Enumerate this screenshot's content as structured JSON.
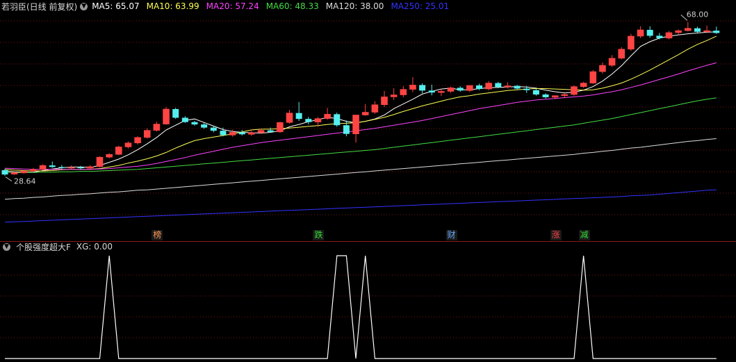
{
  "main_panel": {
    "title": "若羽臣(日线 前复权)",
    "expand_icon": "chevron-down-icon",
    "ma_legend": [
      {
        "label": "MA5: 65.07",
        "color": "#ffffff"
      },
      {
        "label": "MA10: 63.99",
        "color": "#ffff55"
      },
      {
        "label": "MA20: 57.24",
        "color": "#ff44ff"
      },
      {
        "label": "MA60: 48.33",
        "color": "#44dd44"
      },
      {
        "label": "MA120: 38.00",
        "color": "#dddddd"
      },
      {
        "label": "MA250: 25.01",
        "color": "#3333ff"
      }
    ],
    "high_label": "68.00",
    "low_label": "28.64",
    "event_tags": [
      {
        "text": "榜",
        "color": "#ff9955"
      },
      {
        "text": "跌",
        "color": "#33dd33"
      },
      {
        "text": "财",
        "color": "#66aaff"
      },
      {
        "text": "涨",
        "color": "#ff4444"
      },
      {
        "text": "减",
        "color": "#33dd33"
      }
    ]
  },
  "indicator_panel": {
    "title": "个股强度超大F",
    "expand_icon": "chevron-down-icon",
    "value_label": "XG: 0.00",
    "line_color": "#ffffff"
  },
  "colors": {
    "background": "#000000",
    "up_candle": "#ff4444",
    "down_candle": "#55eeee",
    "grid": "#7a1414",
    "separator": "#8b1a1a"
  },
  "chart_data": [
    {
      "type": "candlestick",
      "series_name": "若羽臣(日线 前复权)",
      "ohlc": [
        [
          30.0,
          30.3,
          28.6,
          28.9
        ],
        [
          29.0,
          29.6,
          28.8,
          29.4
        ],
        [
          29.3,
          29.9,
          29.1,
          29.8
        ],
        [
          29.8,
          30.6,
          29.5,
          30.2
        ],
        [
          30.2,
          31.5,
          30.0,
          31.2
        ],
        [
          31.2,
          32.2,
          30.6,
          30.8
        ],
        [
          30.8,
          31.3,
          30.2,
          30.6
        ],
        [
          30.6,
          31.2,
          30.3,
          30.7
        ],
        [
          30.7,
          31.1,
          30.1,
          30.5
        ],
        [
          30.5,
          31.3,
          30.2,
          30.9
        ],
        [
          30.9,
          33.5,
          30.7,
          33.3
        ],
        [
          33.3,
          34.3,
          33.0,
          34.0
        ],
        [
          34.0,
          36.2,
          33.8,
          35.9
        ],
        [
          35.9,
          37.3,
          35.5,
          36.9
        ],
        [
          36.9,
          38.6,
          36.5,
          38.3
        ],
        [
          38.3,
          40.6,
          38.0,
          40.1
        ],
        [
          40.1,
          42.3,
          39.8,
          41.7
        ],
        [
          41.7,
          46.0,
          41.5,
          45.5
        ],
        [
          45.5,
          45.8,
          43.0,
          43.3
        ],
        [
          43.3,
          43.7,
          42.0,
          42.2
        ],
        [
          42.2,
          42.5,
          41.3,
          41.6
        ],
        [
          41.6,
          42.0,
          40.5,
          40.8
        ],
        [
          40.8,
          41.2,
          39.6,
          40.0
        ],
        [
          40.0,
          40.8,
          38.6,
          38.9
        ],
        [
          38.9,
          40.3,
          38.5,
          39.6
        ],
        [
          39.6,
          40.2,
          38.8,
          39.1
        ],
        [
          39.1,
          40.0,
          38.7,
          39.5
        ],
        [
          39.5,
          40.5,
          39.2,
          40.1
        ],
        [
          40.1,
          40.8,
          39.5,
          39.7
        ],
        [
          39.7,
          42.3,
          39.5,
          42.1
        ],
        [
          42.1,
          45.3,
          41.8,
          44.5
        ],
        [
          44.5,
          47.3,
          42.5,
          43.0
        ],
        [
          43.0,
          43.5,
          41.6,
          42.2
        ],
        [
          42.2,
          43.5,
          41.0,
          43.1
        ],
        [
          43.1,
          45.8,
          42.8,
          44.2
        ],
        [
          44.2,
          44.6,
          41.0,
          41.4
        ],
        [
          41.4,
          42.6,
          38.6,
          39.2
        ],
        [
          39.2,
          41.7,
          37.0,
          44.0
        ],
        [
          44.0,
          46.8,
          43.8,
          44.7
        ],
        [
          44.7,
          47.5,
          44.3,
          46.6
        ],
        [
          46.6,
          50.1,
          46.1,
          48.6
        ],
        [
          48.6,
          50.8,
          47.8,
          49.1
        ],
        [
          49.1,
          51.3,
          48.5,
          50.5
        ],
        [
          50.5,
          53.6,
          49.8,
          51.6
        ],
        [
          51.6,
          52.0,
          49.5,
          50.2
        ],
        [
          50.2,
          51.7,
          49.0,
          49.7
        ],
        [
          49.7,
          50.6,
          48.8,
          50.0
        ],
        [
          50.0,
          51.2,
          49.6,
          50.9
        ],
        [
          50.9,
          51.3,
          49.9,
          50.2
        ],
        [
          50.2,
          51.5,
          49.8,
          51.5
        ],
        [
          51.5,
          51.9,
          50.3,
          50.6
        ],
        [
          50.6,
          52.6,
          50.3,
          52.1
        ],
        [
          52.1,
          52.4,
          50.8,
          51.1
        ],
        [
          51.1,
          52.3,
          50.7,
          51.4
        ],
        [
          51.4,
          51.6,
          50.4,
          50.7
        ],
        [
          50.7,
          51.4,
          49.6,
          50.3
        ],
        [
          50.3,
          50.7,
          48.9,
          49.2
        ],
        [
          49.2,
          49.5,
          48.2,
          48.5
        ],
        [
          48.5,
          49.0,
          48.0,
          48.9
        ],
        [
          48.9,
          49.5,
          48.3,
          49.2
        ],
        [
          49.2,
          51.5,
          48.9,
          51.2
        ],
        [
          51.2,
          52.4,
          50.9,
          52.1
        ],
        [
          52.1,
          55.4,
          51.9,
          55.0
        ],
        [
          55.0,
          57.3,
          54.5,
          56.6
        ],
        [
          56.6,
          59.2,
          56.2,
          58.4
        ],
        [
          58.4,
          61.2,
          58.1,
          60.7
        ],
        [
          60.7,
          64.6,
          60.3,
          64.0
        ],
        [
          64.0,
          66.5,
          63.5,
          65.6
        ],
        [
          65.6,
          66.5,
          63.6,
          64.1
        ],
        [
          64.1,
          64.8,
          63.2,
          63.5
        ],
        [
          63.5,
          65.3,
          63.2,
          64.9
        ],
        [
          64.9,
          65.7,
          64.3,
          65.4
        ],
        [
          65.4,
          67.6,
          65.2,
          66.0
        ],
        [
          66.0,
          66.4,
          64.7,
          65.1
        ],
        [
          65.1,
          66.7,
          64.8,
          65.4
        ],
        [
          65.4,
          66.4,
          64.6,
          64.8
        ]
      ],
      "ma": {
        "MA5": [
          29.8,
          29.6,
          29.5,
          29.5,
          29.9,
          30.3,
          30.6,
          30.8,
          30.8,
          30.7,
          31.2,
          32.0,
          32.8,
          33.9,
          35.2,
          36.7,
          38.3,
          40.2,
          41.4,
          42.6,
          43.0,
          42.1,
          41.2,
          40.3,
          39.8,
          39.6,
          39.5,
          39.4,
          39.6,
          40.0,
          41.0,
          41.6,
          42.3,
          42.8,
          43.4,
          43.1,
          42.4,
          42.0,
          42.4,
          43.0,
          44.0,
          45.6,
          46.8,
          48.0,
          49.3,
          50.0,
          50.6,
          50.8,
          50.4,
          50.4,
          50.7,
          50.9,
          51.0,
          51.1,
          51.2,
          51.1,
          50.8,
          50.3,
          49.9,
          49.6,
          49.8,
          50.3,
          51.2,
          52.6,
          54.4,
          56.5,
          59.0,
          61.4,
          62.6,
          63.5,
          64.0,
          64.3,
          64.6,
          64.8,
          65.0,
          65.1
        ],
        "MA10": [
          30.2,
          30.0,
          29.9,
          29.8,
          29.8,
          29.9,
          30.1,
          30.2,
          30.2,
          30.2,
          30.4,
          30.8,
          31.2,
          31.8,
          32.3,
          32.9,
          33.6,
          34.5,
          35.6,
          36.6,
          37.5,
          38.0,
          38.4,
          38.8,
          39.2,
          39.7,
          40.2,
          40.4,
          40.4,
          40.5,
          40.7,
          40.9,
          41.1,
          41.3,
          41.6,
          41.8,
          41.9,
          42.0,
          42.4,
          42.9,
          43.4,
          44.1,
          44.9,
          45.6,
          46.3,
          46.9,
          47.5,
          48.1,
          48.6,
          48.9,
          49.3,
          49.6,
          49.9,
          50.2,
          50.4,
          50.6,
          50.7,
          50.7,
          50.6,
          50.5,
          50.4,
          50.3,
          50.4,
          50.8,
          51.4,
          52.1,
          53.1,
          54.2,
          55.4,
          56.7,
          58.0,
          59.3,
          60.7,
          61.9,
          62.9,
          63.99
        ],
        "MA20": [
          30.5,
          30.4,
          30.3,
          30.2,
          30.2,
          30.2,
          30.2,
          30.2,
          30.2,
          30.2,
          30.3,
          30.4,
          30.6,
          30.8,
          31.0,
          31.3,
          31.7,
          32.2,
          32.7,
          33.2,
          33.8,
          34.3,
          34.8,
          35.3,
          35.8,
          36.2,
          36.6,
          37.0,
          37.3,
          37.6,
          37.9,
          38.2,
          38.5,
          38.8,
          39.1,
          39.4,
          39.7,
          40.0,
          40.3,
          40.6,
          41.0,
          41.4,
          41.8,
          42.2,
          42.6,
          43.1,
          43.6,
          44.1,
          44.6,
          45.1,
          45.6,
          46.0,
          46.4,
          46.8,
          47.2,
          47.5,
          47.8,
          48.0,
          48.2,
          48.4,
          48.6,
          48.8,
          49.1,
          49.5,
          49.9,
          50.4,
          51.0,
          51.6,
          52.3,
          53.0,
          53.7,
          54.4,
          55.2,
          55.9,
          56.6,
          57.24
        ],
        "MA60": [
          29.4,
          29.4,
          29.4,
          29.4,
          29.5,
          29.5,
          29.6,
          29.6,
          29.7,
          29.7,
          29.8,
          29.9,
          30.0,
          30.1,
          30.2,
          30.4,
          30.6,
          30.8,
          31.0,
          31.2,
          31.4,
          31.6,
          31.8,
          32.0,
          32.2,
          32.4,
          32.6,
          32.8,
          33.0,
          33.2,
          33.4,
          33.6,
          33.8,
          34.0,
          34.2,
          34.4,
          34.6,
          34.8,
          35.0,
          35.2,
          35.5,
          35.8,
          36.1,
          36.4,
          36.7,
          37.0,
          37.3,
          37.6,
          37.9,
          38.2,
          38.5,
          38.8,
          39.1,
          39.4,
          39.7,
          40.0,
          40.3,
          40.6,
          40.9,
          41.2,
          41.5,
          41.9,
          42.3,
          42.7,
          43.1,
          43.6,
          44.1,
          44.6,
          45.1,
          45.6,
          46.1,
          46.6,
          47.1,
          47.6,
          48.0,
          48.33
        ],
        "MA120": [
          22.6,
          22.8,
          22.9,
          23.1,
          23.2,
          23.4,
          23.6,
          23.7,
          23.9,
          24.0,
          24.2,
          24.4,
          24.5,
          24.7,
          24.9,
          25.0,
          25.2,
          25.4,
          25.6,
          25.8,
          26.0,
          26.2,
          26.4,
          26.6,
          26.8,
          27.0,
          27.2,
          27.4,
          27.6,
          27.8,
          28.0,
          28.2,
          28.4,
          28.6,
          28.8,
          29.0,
          29.2,
          29.4,
          29.6,
          29.8,
          30.0,
          30.2,
          30.4,
          30.6,
          30.8,
          31.0,
          31.2,
          31.4,
          31.6,
          31.8,
          32.0,
          32.2,
          32.4,
          32.6,
          32.8,
          33.0,
          33.2,
          33.4,
          33.6,
          33.8,
          34.0,
          34.3,
          34.5,
          34.8,
          35.0,
          35.3,
          35.6,
          35.8,
          36.1,
          36.4,
          36.7,
          37.0,
          37.3,
          37.5,
          37.8,
          38.0
        ],
        "MA250": [
          16.8,
          16.9,
          17.0,
          17.1,
          17.2,
          17.3,
          17.4,
          17.5,
          17.6,
          17.7,
          17.8,
          17.9,
          18.0,
          18.1,
          18.2,
          18.3,
          18.4,
          18.5,
          18.6,
          18.7,
          18.8,
          18.9,
          19.0,
          19.1,
          19.2,
          19.3,
          19.4,
          19.5,
          19.6,
          19.7,
          19.8,
          19.9,
          20.0,
          20.1,
          20.2,
          20.3,
          20.4,
          20.5,
          20.6,
          20.7,
          20.8,
          20.9,
          21.0,
          21.1,
          21.2,
          21.3,
          21.4,
          21.5,
          21.6,
          21.7,
          21.8,
          21.9,
          22.0,
          22.1,
          22.2,
          22.3,
          22.4,
          22.5,
          22.6,
          22.7,
          22.8,
          22.9,
          23.0,
          23.1,
          23.2,
          23.3,
          23.5,
          23.6,
          23.7,
          23.9,
          24.1,
          24.3,
          24.5,
          24.7,
          24.9,
          25.01
        ]
      },
      "high_marker": {
        "bar": 72,
        "value": 68.0
      },
      "low_marker": {
        "bar": 0,
        "value": 28.64
      },
      "event_tags": [
        {
          "bar": 16,
          "text": "榜"
        },
        {
          "bar": 33,
          "text": "跌"
        },
        {
          "bar": 47,
          "text": "财"
        },
        {
          "bar": 58,
          "text": "涨"
        },
        {
          "bar": 61,
          "text": "减"
        }
      ],
      "y_range": [
        15,
        70
      ],
      "grid": true
    },
    {
      "type": "line",
      "series_name": "XG",
      "x": [
        0,
        10,
        11,
        12,
        34,
        35,
        36,
        37,
        38,
        39,
        40,
        60,
        61,
        62,
        75
      ],
      "values": [
        0,
        0,
        1,
        0,
        0,
        1,
        1,
        0,
        1,
        0,
        0,
        0,
        1,
        0,
        0
      ],
      "y_range": [
        0,
        1
      ],
      "grid": true
    }
  ]
}
